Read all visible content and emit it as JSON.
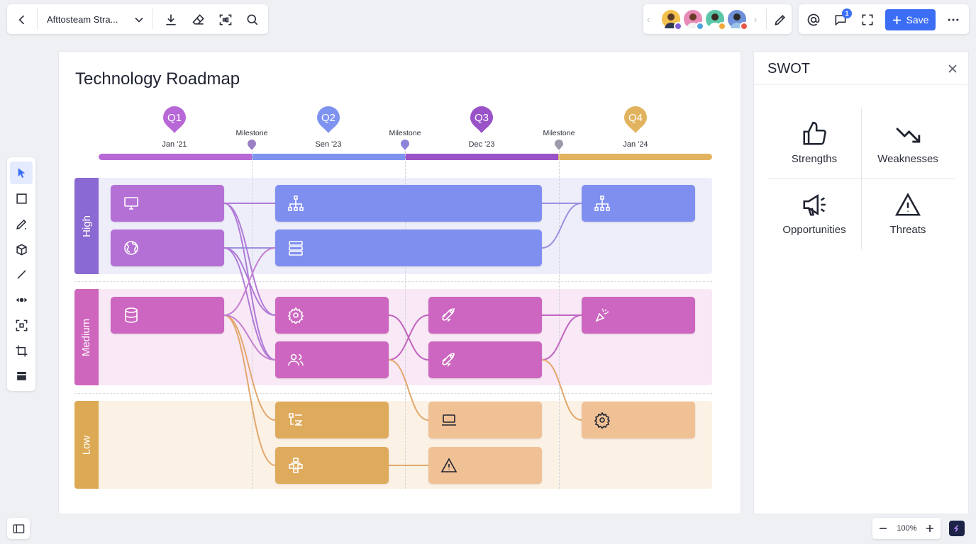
{
  "topbar": {
    "back_icon": "chevron-left-icon",
    "document_title": "Afttosteam Stra...",
    "menu_icon": "chevron-down-icon",
    "tools": [
      "download-icon",
      "eraser-icon",
      "scan-icon",
      "search-icon"
    ]
  },
  "collab": {
    "collaborators": [
      {
        "name": "collaborator-1",
        "color": "#f2c14e",
        "dot": "#7c5cd6"
      },
      {
        "name": "collaborator-2",
        "color": "#e88ab6",
        "dot": "#4fa3e0"
      },
      {
        "name": "collaborator-3",
        "color": "#5cc6a8",
        "dot": "#f2a93b"
      },
      {
        "name": "collaborator-4",
        "color": "#6f8fd8",
        "dot": "#e5594a"
      }
    ]
  },
  "actions": {
    "comments_count": "1",
    "save_label": "Save"
  },
  "board": {
    "title": "Technology Roadmap",
    "quarters": [
      {
        "label": "Q1",
        "date": "Jan '21",
        "color": "#b768d6"
      },
      {
        "label": "Q2",
        "date": "Sen '23",
        "color": "#7e93ef"
      },
      {
        "label": "Q3",
        "date": "Dec '23",
        "color": "#9a52c8"
      },
      {
        "label": "Q4",
        "date": "Jan '24",
        "color": "#e2b35f"
      }
    ],
    "milestones": [
      "Milestone",
      "Milestone",
      "Milestone"
    ],
    "bands": [
      {
        "label": "High",
        "color": "#8b69d2",
        "bg": "#eeeefb"
      },
      {
        "label": "Medium",
        "color": "#cf66bd",
        "bg": "#f9e8f5"
      },
      {
        "label": "Low",
        "color": "#dcaa55",
        "bg": "#fbf2e5"
      }
    ]
  },
  "swot": {
    "title": "SWOT",
    "items": [
      {
        "label": "Strengths",
        "icon": "thumbs-up-icon"
      },
      {
        "label": "Weaknesses",
        "icon": "trend-down-icon"
      },
      {
        "label": "Opportunities",
        "icon": "megaphone-icon"
      },
      {
        "label": "Threats",
        "icon": "warning-icon"
      }
    ]
  },
  "zoom": {
    "level": "100%"
  }
}
